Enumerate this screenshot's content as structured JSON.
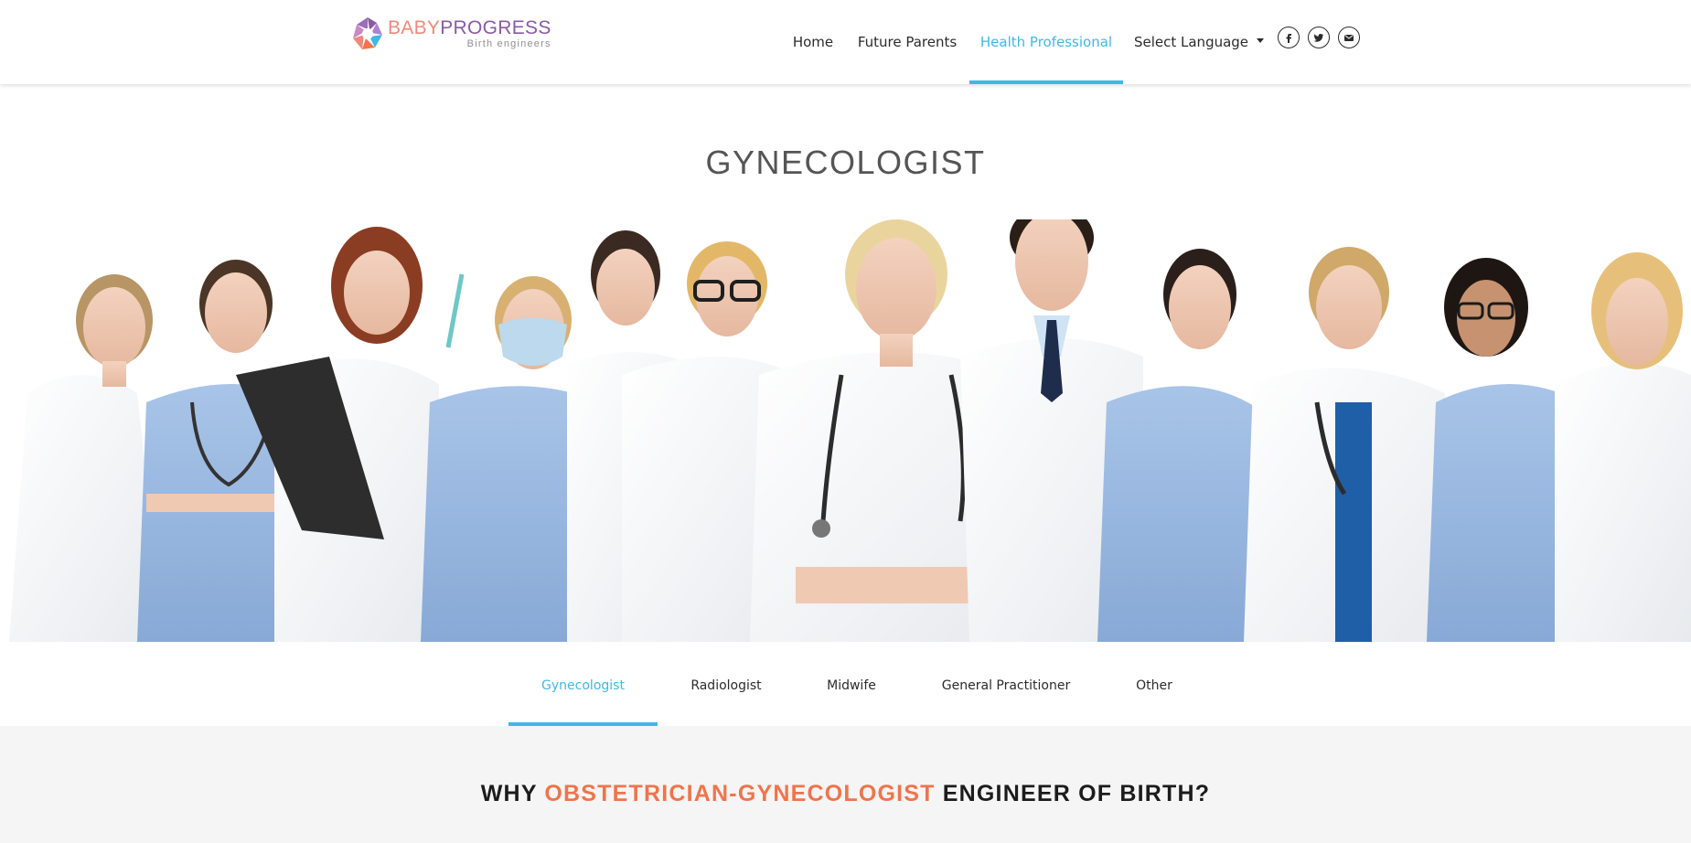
{
  "brand": {
    "word_part1": "BABY",
    "word_part2": "PROGRESS",
    "tagline": "Birth engineers",
    "colors": {
      "baby": "#ef8a7b",
      "progress": "#8a5aa6"
    }
  },
  "nav": {
    "items": [
      {
        "label": "Home"
      },
      {
        "label": "Future Parents"
      },
      {
        "label": "Health Professional",
        "active": true
      },
      {
        "label": "Select Language"
      }
    ],
    "social": [
      {
        "icon": "facebook-icon"
      },
      {
        "icon": "twitter-icon"
      },
      {
        "icon": "email-icon"
      }
    ],
    "accent_color": "#3fb8e6"
  },
  "page": {
    "title": "GYNECOLOGIST",
    "hero_image": "group-of-smiling-medical-staff"
  },
  "tabs": [
    {
      "label": "Gynecologist",
      "active": true
    },
    {
      "label": "Radiologist"
    },
    {
      "label": "Midwife"
    },
    {
      "label": "General Practitioner"
    },
    {
      "label": "Other"
    }
  ],
  "why": {
    "prefix": "WHY ",
    "highlight": "OBSTETRICIAN-GYNECOLOGIST",
    "suffix": " ENGINEER OF BIRTH?",
    "highlight_color": "#f0744c"
  }
}
